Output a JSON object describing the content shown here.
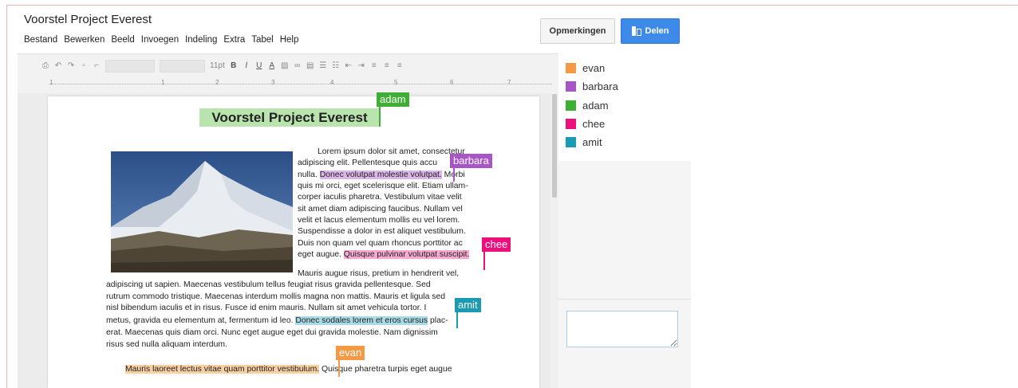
{
  "document": {
    "title": "Voorstel Project Everest",
    "menu": [
      "Bestand",
      "Bewerken",
      "Beeld",
      "Invoegen",
      "Indeling",
      "Extra",
      "Tabel",
      "Help"
    ]
  },
  "buttons": {
    "comments": "Opmerkingen",
    "share": "Delen"
  },
  "toolbar": {
    "font_size": "11pt",
    "bold": "B",
    "italic": "I",
    "underline": "U",
    "text_color": "A"
  },
  "ruler": {
    "marks": [
      "1",
      "1",
      "2",
      "3",
      "4",
      "5",
      "6",
      "7"
    ]
  },
  "page": {
    "heading": "Voorstel Project Everest",
    "para1": {
      "a": "Lorem ipsum dolor sit amet, consectetur",
      "b": "adipiscing elit. Pellentesque quis accu",
      "c1": "nulla. ",
      "c_hl": "Donec volutpat molestie volutpat.",
      "c2": " Morbi",
      "d": "quis mi orci, eget scelerisque elit. Etiam ullam-",
      "e": "corper iaculis pharetra. Vestibulum vitae velit",
      "f": "sit amet diam adipiscing faucibus. Nullam vel",
      "g": "velit et lacus elementum mollis eu vel lorem.",
      "h": "Suspendisse a dolor in est aliquet vestibulum.",
      "i": "Duis non quam vel quam rhoncus porttitor ac",
      "j1": "eget augue. ",
      "j_hl": "Quisque pulvinar volutpat suscipit.",
      "k": "Mauris augue risus, pretium in hendrerit vel,",
      "l": "adipiscing ut sapien. Maecenas vestibulum tellus feugiat risus gravida pellentesque. Sed",
      "m": "rutrum commodo tristique. Maecenas interdum mollis magna non mattis. Mauris et ligula sed",
      "n": "nisl bibendum iaculis et in risus. Fusce id enim mauris. Nullam sit amet vehicula tortor. I",
      "o1": "metus, gravida eu elementum at, fermentum id leo. ",
      "o_hl": "Donec sodales lorem et eros cursus",
      "o2": " plac-",
      "p": "erat. Maecenas quis diam orci. Nunc eget augue eget dui gravida molestie. Nam dignissim",
      "q": "risus sed nulla aliquam interdum."
    },
    "para2": {
      "hl": "Mauris laoreet lectus vitae quam porttitor vestibulum.",
      "rest": " Quisque pharetra turpis eget augue"
    }
  },
  "cursors": {
    "adam": "adam",
    "barbara": "barbara",
    "chee": "chee",
    "amit": "amit",
    "evan": "evan"
  },
  "collaborators": [
    {
      "name": "evan",
      "color": "#f49a45"
    },
    {
      "name": "barbara",
      "color": "#a855c8"
    },
    {
      "name": "adam",
      "color": "#3fae34"
    },
    {
      "name": "chee",
      "color": "#ec0f7c"
    },
    {
      "name": "amit",
      "color": "#1a9bb3"
    }
  ],
  "chat": {
    "placeholder": ""
  }
}
